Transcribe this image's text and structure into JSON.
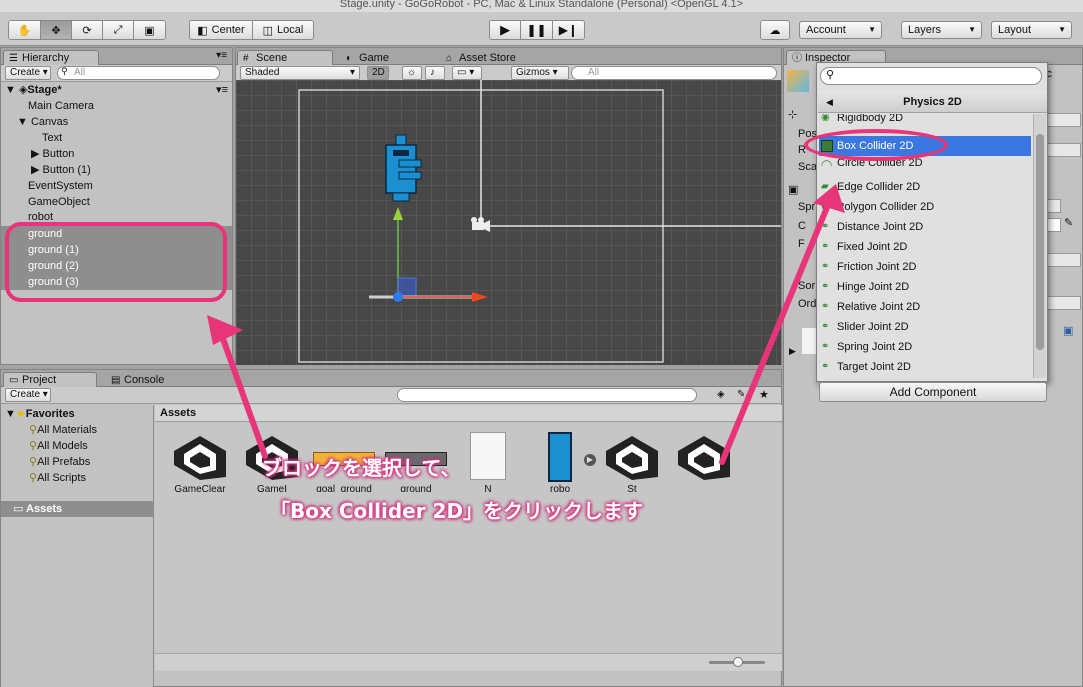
{
  "window": {
    "title": "Stage.unity - GoGoRobot - PC, Mac & Linux Standalone (Personal) <OpenGL 4.1>"
  },
  "toolbar": {
    "tools": [
      "hand-icon",
      "move-icon",
      "rotate-icon",
      "scale-icon",
      "rect-icon"
    ],
    "pivot_label": "Center",
    "space_label": "Local",
    "play": [
      "play-icon",
      "pause-icon",
      "step-icon"
    ],
    "account_label": "Account",
    "layers_label": "Layers",
    "layout_label": "Layout"
  },
  "hierarchy": {
    "tab_label": "Hierarchy",
    "create_label": "Create",
    "search_placeholder": "All",
    "scene_name": "Stage*",
    "items": [
      {
        "label": "Main Camera"
      },
      {
        "label": "Canvas"
      },
      {
        "label": "Text"
      },
      {
        "label": "Button"
      },
      {
        "label": "Button (1)"
      },
      {
        "label": "EventSystem"
      },
      {
        "label": "GameObject"
      },
      {
        "label": "robot"
      },
      {
        "label": "ground"
      },
      {
        "label": "ground (1)"
      },
      {
        "label": "ground (2)"
      },
      {
        "label": "ground (3)"
      }
    ]
  },
  "scene": {
    "tabs": [
      "Scene",
      "Game",
      "Asset Store"
    ],
    "shading_label": "Shaded",
    "mode_2d_label": "2D",
    "gizmos_label": "Gizmos",
    "search_placeholder": "All"
  },
  "inspector": {
    "tab_label": "Inspector",
    "partial_labels": [
      "Pos",
      "R",
      "Sca",
      "Spr",
      "C",
      "F",
      "Sor",
      "Ord"
    ],
    "tag_partial": "ic"
  },
  "add_component": {
    "search_value": "",
    "category_title": "Physics 2D",
    "items": [
      {
        "label": "Rigidbody 2D"
      },
      {
        "label": "Box Collider 2D"
      },
      {
        "label": "Circle Collider 2D"
      },
      {
        "label": "Edge Collider 2D"
      },
      {
        "label": "Polygon Collider 2D"
      },
      {
        "label": "Distance Joint 2D"
      },
      {
        "label": "Fixed Joint 2D"
      },
      {
        "label": "Friction Joint 2D"
      },
      {
        "label": "Hinge Joint 2D"
      },
      {
        "label": "Relative Joint 2D"
      },
      {
        "label": "Slider Joint 2D"
      },
      {
        "label": "Spring Joint 2D"
      },
      {
        "label": "Target Joint 2D"
      }
    ],
    "button_label": "Add Component"
  },
  "project": {
    "tabs": [
      "Project",
      "Console"
    ],
    "create_label": "Create",
    "favorites_label": "Favorites",
    "favorites": [
      "All Materials",
      "All Models",
      "All Prefabs",
      "All Scripts"
    ],
    "assets_folder_label": "Assets",
    "breadcrumb": "Assets",
    "assets": [
      {
        "label": "GameClear"
      },
      {
        "label": "GameI"
      },
      {
        "label": "goal_ground"
      },
      {
        "label": "ground"
      },
      {
        "label": "N"
      },
      {
        "label": "robo"
      },
      {
        "label": "St"
      }
    ]
  },
  "annotation": {
    "line1": "ブロックを選択して、",
    "line2": "「Box Collider 2D」をクリックします",
    "color": "#e8357a"
  }
}
